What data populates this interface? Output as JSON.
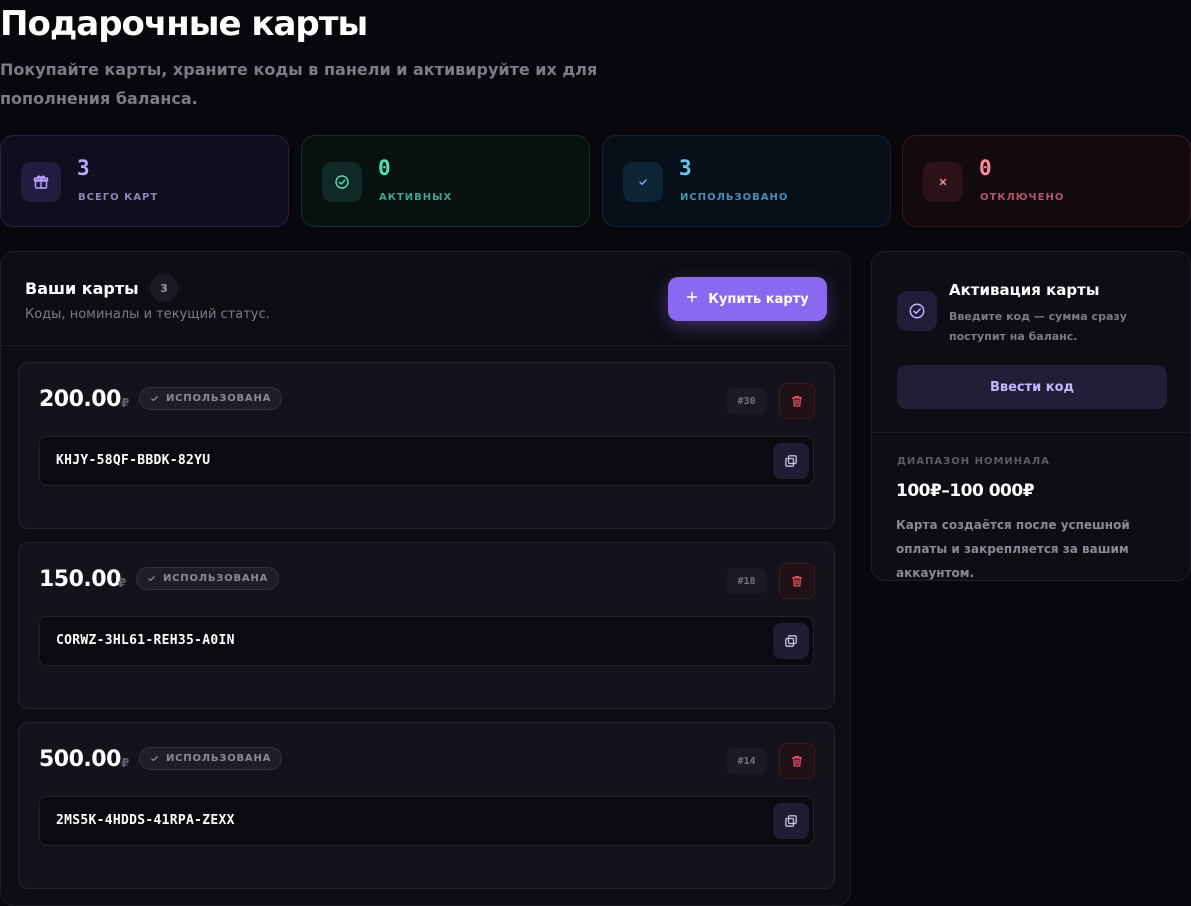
{
  "header": {
    "title": "Подарочные карты",
    "subtitle": "Покупайте карты, храните коды в панели и активируйте их для пополнения баланса."
  },
  "stats": {
    "total": {
      "value": "3",
      "label": "всего карт",
      "icon": "gift-icon"
    },
    "active": {
      "value": "0",
      "label": "активных",
      "icon": "check-circle-icon"
    },
    "used": {
      "value": "3",
      "label": "использовано",
      "icon": "check-icon"
    },
    "disabled": {
      "value": "0",
      "label": "отключено",
      "icon": "close-icon"
    }
  },
  "cards_panel": {
    "title": "Ваши карты",
    "count": "3",
    "description": "Коды, номиналы и текущий статус.",
    "buy_button_label": "Купить карту",
    "currency_symbol": "₽",
    "cards": [
      {
        "amount": "200.00",
        "status": "использована",
        "id": "#30",
        "code": "KHJY-58QF-BBDK-82YU"
      },
      {
        "amount": "150.00",
        "status": "использована",
        "id": "#18",
        "code": "CORWZ-3HL61-REH35-A0IN"
      },
      {
        "amount": "500.00",
        "status": "использована",
        "id": "#14",
        "code": "2MS5K-4HDDS-41RPA-ZEXX"
      }
    ]
  },
  "activation": {
    "title": "Активация карты",
    "description": "Введите код — сумма сразу поступит на баланс.",
    "button_label": "Ввести код",
    "range_label": "ДИАПАЗОН НОМИНАЛА",
    "range_value": "100₽–100 000₽",
    "note": "Карта создаётся после успешной оплаты и закрепляется за вашим аккаунтом."
  },
  "colors": {
    "accent": "#8b68f0",
    "active": "#4de3b2",
    "used": "#6cc4f4",
    "disabled": "#ff8d9a"
  }
}
